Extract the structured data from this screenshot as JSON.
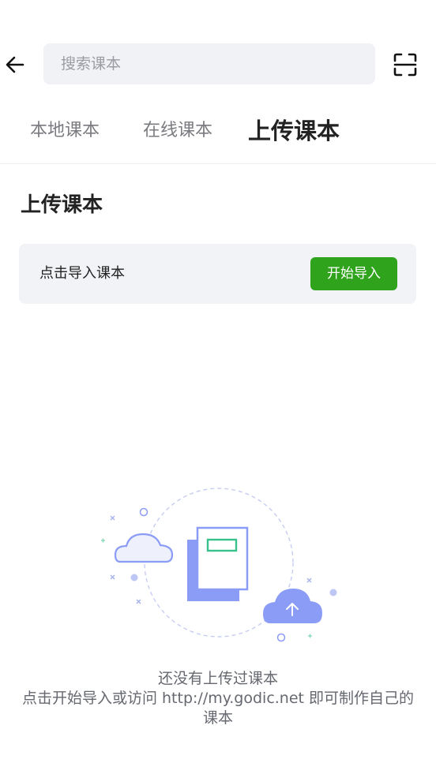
{
  "search": {
    "placeholder": "搜索课本"
  },
  "tabs": [
    {
      "label": "本地课本",
      "active": false
    },
    {
      "label": "在线课本",
      "active": false
    },
    {
      "label": "上传课本",
      "active": true
    }
  ],
  "section": {
    "title": "上传课本"
  },
  "import_card": {
    "label": "点击导入课本",
    "button_label": "开始导入"
  },
  "empty_state": {
    "line1": "还没有上传过课本",
    "line2": "点击开始导入或访问 http://my.godic.net 即可制作自己的课本"
  },
  "colors": {
    "accent_green": "#2fa31c",
    "illustration_blue": "#8b9cf7"
  },
  "icons": {
    "back": "arrow-left-icon",
    "scan": "scan-icon",
    "illustration": "upload-empty-illustration"
  }
}
